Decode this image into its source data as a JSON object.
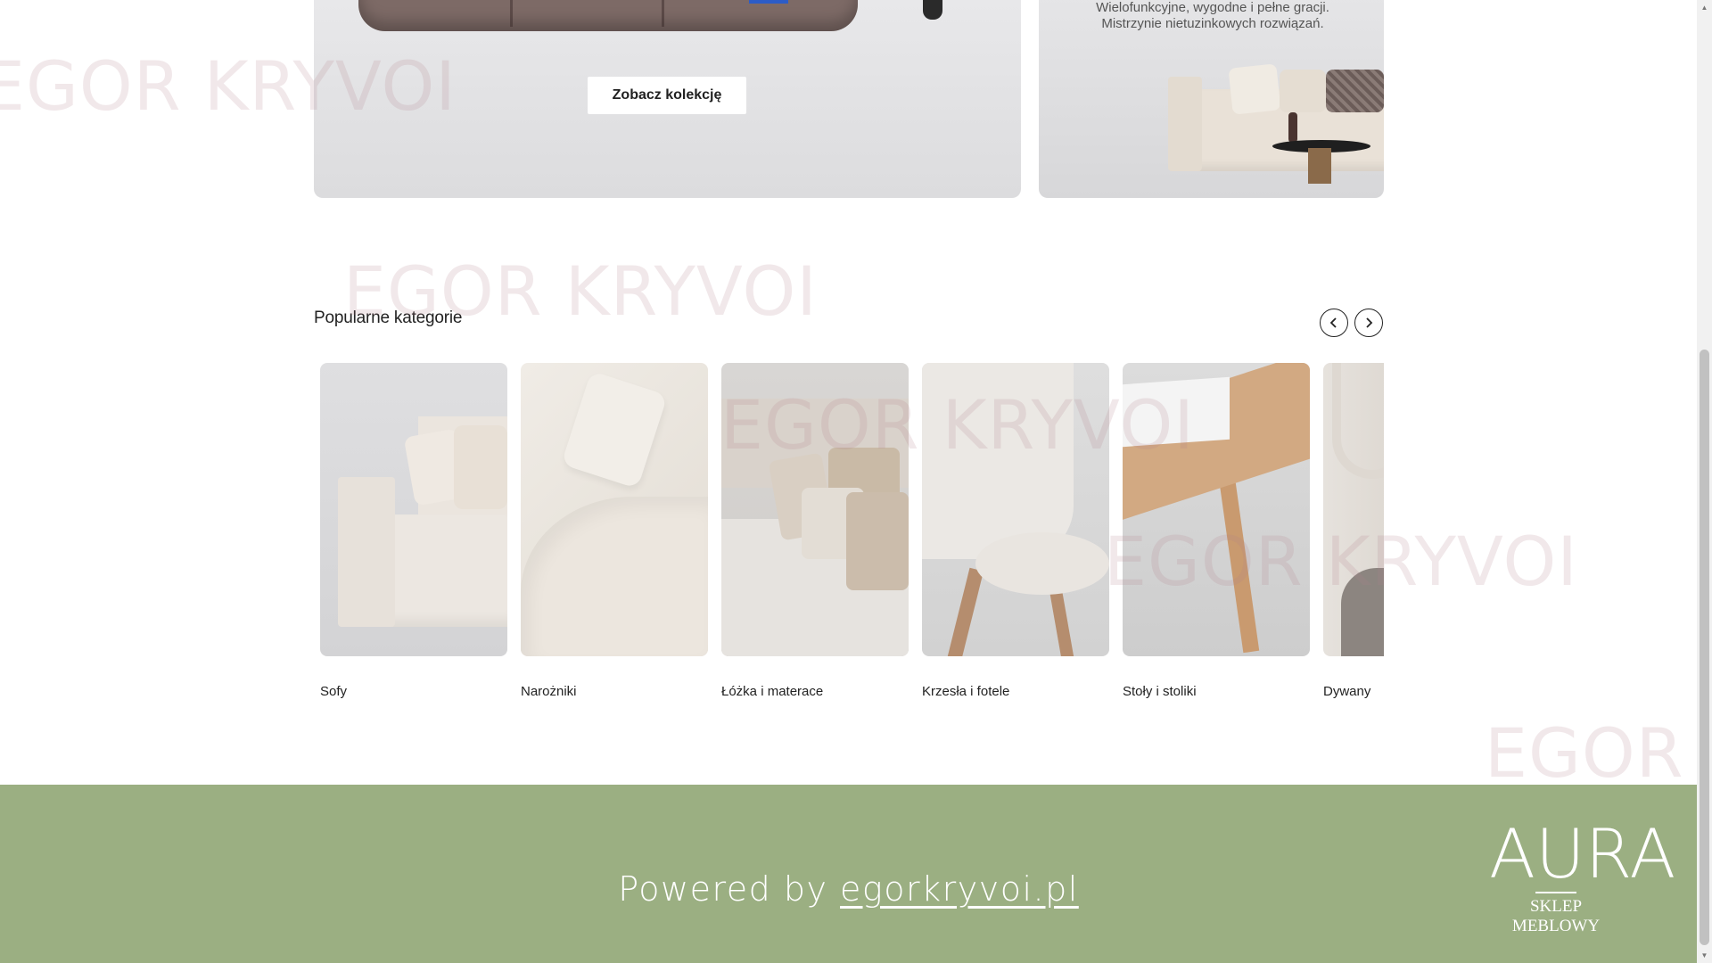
{
  "promo_left": {
    "cta_label": "Zobacz kolekcję"
  },
  "promo_right": {
    "text": "Wielofunkcyjne, wygodne i pełne gracji. Mistrzynie nietuzinkowych rozwiązań."
  },
  "categories_section": {
    "title": "Popularne kategorie",
    "prev_icon": "chevron-left-icon",
    "next_icon": "chevron-right-icon",
    "items": [
      {
        "label": "Sofy"
      },
      {
        "label": "Narożniki"
      },
      {
        "label": "Łóżka i materace"
      },
      {
        "label": "Krzesła i fotele"
      },
      {
        "label": "Stoły i stoliki"
      },
      {
        "label": "Dywany"
      }
    ]
  },
  "watermark": {
    "text": "EGOR KRYVOI"
  },
  "footer": {
    "powered_prefix": "Powered by ",
    "powered_link": "egorkryvoi.pl",
    "logo_main": "AURA",
    "logo_sub": "SKLEP MEBLOWY",
    "background_color": "#9baf82"
  }
}
